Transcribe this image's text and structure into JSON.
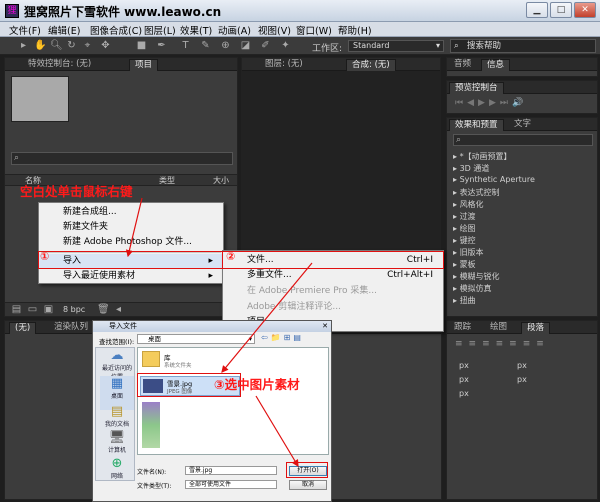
{
  "window": {
    "title": "狸窝照片下雪软件 www.leawo.cn",
    "logo": "logo-icon"
  },
  "menubar": [
    "文件(F)",
    "编辑(E)",
    "图像合成(C)",
    "图层(L)",
    "效果(T)",
    "动画(A)",
    "视图(V)",
    "窗口(W)",
    "帮助(H)"
  ],
  "toolbar": {
    "workspace_label": "工作区:",
    "workspace_value": "Standard",
    "search_help": "搜索帮助"
  },
  "left_panel": {
    "tabs": [
      "特效控制台: (无)",
      "项目"
    ],
    "col_name": "名称",
    "col_type": "类型",
    "col_size": "大小",
    "bpc": "8 bpc"
  },
  "comp_panel": {
    "tabs": [
      "图层: (无)",
      "合成: (无)"
    ]
  },
  "right_panel": {
    "tabs1": [
      "音频",
      "信息"
    ],
    "preview_tab": "预览控制台",
    "effects_tabs": [
      "效果和预置",
      "文字"
    ],
    "effects": [
      "*【动画预置】",
      "3D 通道",
      "Synthetic Aperture",
      "表达式控制",
      "风格化",
      "过渡",
      "绘图",
      "键控",
      "旧版本",
      "蒙板",
      "模糊与锐化",
      "模拟仿真",
      "扭曲"
    ],
    "bottom_tabs": [
      "跟踪",
      "绘图",
      "段落"
    ],
    "px_labels": [
      "px",
      "px",
      "px",
      "px",
      "px"
    ]
  },
  "timeline_tabs": [
    "(无)",
    "渲染队列"
  ],
  "context_menu": {
    "items": [
      "新建合成组...",
      "新建文件夹",
      "新建 Adobe Photoshop 文件...",
      "导入",
      "导入最近使用素材"
    ]
  },
  "submenu": {
    "items": [
      {
        "label": "文件...",
        "shortcut": "Ctrl+I",
        "disabled": false
      },
      {
        "label": "多重文件...",
        "shortcut": "Ctrl+Alt+I",
        "disabled": false
      },
      {
        "label": "在 Adobe Premiere Pro 采集...",
        "shortcut": "",
        "disabled": true
      },
      {
        "label": "Adobe 剪辑注释评论...",
        "shortcut": "",
        "disabled": true
      },
      {
        "label": "项目...",
        "shortcut": "",
        "disabled": false
      }
    ]
  },
  "annotations": {
    "right_click": "空白处单击鼠标右键",
    "step1": "①",
    "step2": "②",
    "step3": "③选中图片素材"
  },
  "dialog": {
    "title": "导入文件",
    "lookin_label": "查找范围(I):",
    "lookin_value": "桌面",
    "nav": [
      "最近访问的位置",
      "桌面",
      "我的文档",
      "计算机",
      "网络"
    ],
    "files": [
      {
        "name": "库",
        "sub": "系统文件夹"
      },
      {
        "name": "雪景.jpg",
        "sub": "JPEG 图像"
      }
    ],
    "filename_label": "文件名(N):",
    "filename_value": "雪景.jpg",
    "filetype_label": "文件类型(T):",
    "filetype_value": "全部可使用文件",
    "open_btn": "打开(O)",
    "cancel_btn": "取消"
  }
}
